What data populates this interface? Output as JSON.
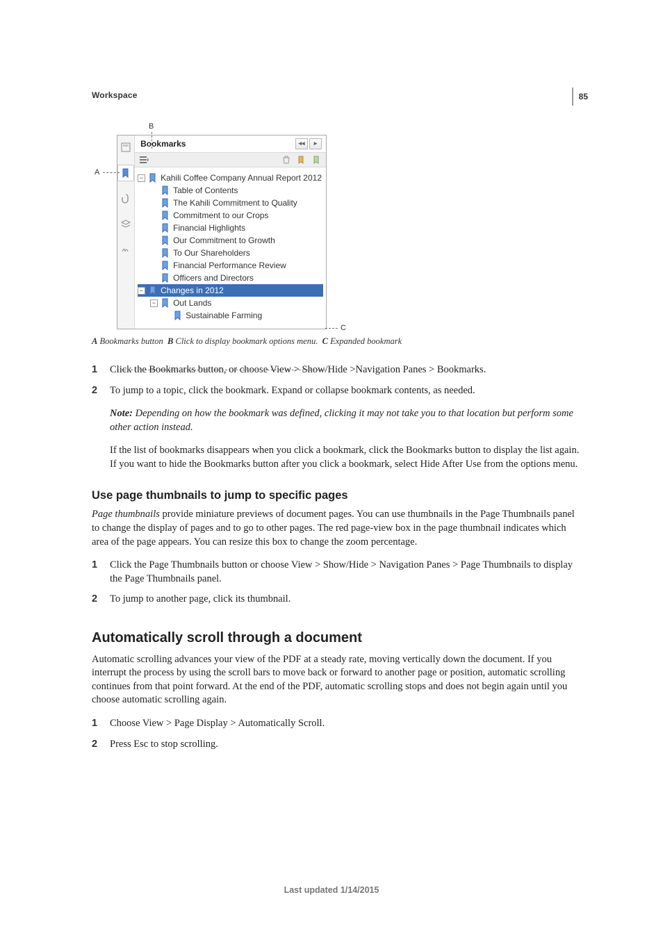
{
  "page_number": "85",
  "breadcrumb": "Workspace",
  "figure": {
    "panel_title": "Bookmarks",
    "tree": {
      "root": "Kahili Coffee Company Annual Report 2012",
      "items": [
        "Table of Contents",
        "The Kahili Commitment to Quality",
        "Commitment to our Crops",
        "Financial Highlights",
        "Our Commitment to Growth",
        "To Our Shareholders",
        "Financial Performance Review",
        "Officers and Directors"
      ],
      "selected": "Changes in 2012",
      "sub1": "Out Lands",
      "sub2": "Sustainable Farming"
    },
    "callouts": {
      "A": "A",
      "B": "B",
      "C": "C"
    },
    "caption": {
      "A": {
        "key": "A",
        "text": "Bookmarks button"
      },
      "B": {
        "key": "B",
        "text": "Click to display bookmark options menu."
      },
      "C": {
        "key": "C",
        "text": "Expanded bookmark"
      }
    }
  },
  "list1": {
    "i1": {
      "num": "1",
      "text": "Click the Bookmarks button, or choose View > Show/Hide >Navigation Panes > Bookmarks."
    },
    "i2": {
      "num": "2",
      "text": "To jump to a topic, click the bookmark. Expand or collapse bookmark contents, as needed."
    }
  },
  "note": {
    "label": "Note:",
    "text": "Depending on how the bookmark was defined, clicking it may not take you to that location but perform some other action instead."
  },
  "para_after_list1": "If the list of bookmarks disappears when you click a bookmark, click the Bookmarks button to display the list again. If you want to hide the Bookmarks button after you click a bookmark, select Hide After Use from the options menu.",
  "sub1": {
    "heading": "Use page thumbnails to jump to specific pages",
    "intro_runin": "Page thumbnails",
    "intro_rest": " provide miniature previews of document pages. You can use thumbnails in the Page Thumbnails panel to change the display of pages and to go to other pages. The red page-view box in the page thumbnail indicates which area of the page appears. You can resize this box to change the zoom percentage.",
    "list": {
      "i1": {
        "num": "1",
        "text": "Click the Page Thumbnails button or choose View > Show/Hide > Navigation Panes > Page Thumbnails to display the Page Thumbnails panel."
      },
      "i2": {
        "num": "2",
        "text": "To jump to another page, click its thumbnail."
      }
    }
  },
  "sub2": {
    "heading": "Automatically scroll through a document",
    "intro": "Automatic scrolling advances your view of the PDF at a steady rate, moving vertically down the document. If you interrupt the process by using the scroll bars to move back or forward to another page or position, automatic scrolling continues from that point forward. At the end of the PDF, automatic scrolling stops and does not begin again until you choose automatic scrolling again.",
    "list": {
      "i1": {
        "num": "1",
        "text": "Choose View > Page Display > Automatically Scroll."
      },
      "i2": {
        "num": "2",
        "text": "Press Esc to stop scrolling."
      }
    }
  },
  "footer": "Last updated 1/14/2015"
}
